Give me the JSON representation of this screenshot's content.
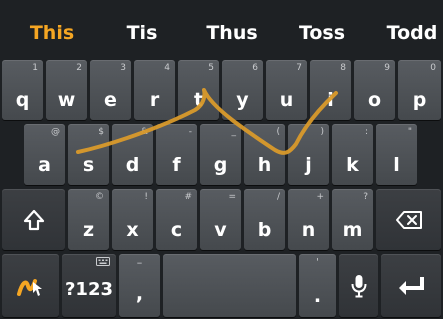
{
  "suggestions": [
    "This",
    "Tis",
    "Thus",
    "Toss",
    "Todd"
  ],
  "row1": [
    {
      "label": "q",
      "hint": "1"
    },
    {
      "label": "w",
      "hint": "2"
    },
    {
      "label": "e",
      "hint": "3"
    },
    {
      "label": "r",
      "hint": "4"
    },
    {
      "label": "t",
      "hint": "5"
    },
    {
      "label": "y",
      "hint": "6"
    },
    {
      "label": "u",
      "hint": "7"
    },
    {
      "label": "i",
      "hint": "8"
    },
    {
      "label": "o",
      "hint": "9"
    },
    {
      "label": "p",
      "hint": "0"
    }
  ],
  "row2": [
    {
      "label": "a",
      "hint": "@"
    },
    {
      "label": "s",
      "hint": "$"
    },
    {
      "label": "d",
      "hint": "&"
    },
    {
      "label": "f",
      "hint": "-"
    },
    {
      "label": "g",
      "hint": "_"
    },
    {
      "label": "h",
      "hint": "("
    },
    {
      "label": "j",
      "hint": ")"
    },
    {
      "label": "k",
      "hint": ":"
    },
    {
      "label": "l",
      "hint": "\""
    }
  ],
  "row3": [
    {
      "label": "z",
      "hint": "©"
    },
    {
      "label": "x",
      "hint": "!"
    },
    {
      "label": "c",
      "hint": "#"
    },
    {
      "label": "v",
      "hint": "="
    },
    {
      "label": "b",
      "hint": "/"
    },
    {
      "label": "n",
      "hint": "+"
    },
    {
      "label": "m",
      "hint": "?"
    }
  ],
  "bottom": {
    "symbols_label": "?123",
    "comma_label": ",",
    "comma_hint": "–",
    "period_label": ".",
    "period_hint": "'"
  },
  "icons": {
    "shift": "shift-icon",
    "backspace": "backspace-icon",
    "swipe": "swipe-typing-icon",
    "mic": "microphone-icon",
    "enter": "enter-icon",
    "emoji_hint": "keyboard-hint-icon"
  },
  "colors": {
    "accent": "#f5a623",
    "trace": "#d99a2b",
    "background": "#1e2124",
    "key": "#4e5256"
  }
}
